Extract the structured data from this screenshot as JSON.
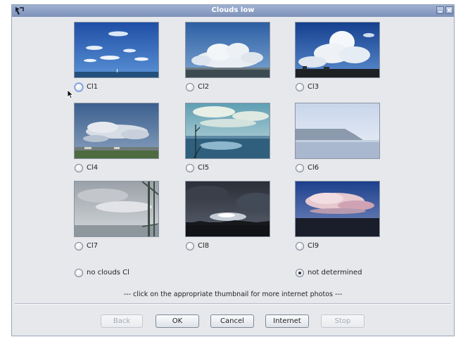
{
  "window": {
    "title": "Clouds low"
  },
  "options": [
    {
      "label": "Cl1",
      "selected": false,
      "focused": true
    },
    {
      "label": "Cl2",
      "selected": false
    },
    {
      "label": "Cl3",
      "selected": false
    },
    {
      "label": "Cl4",
      "selected": false
    },
    {
      "label": "Cl5",
      "selected": false
    },
    {
      "label": "Cl6",
      "selected": false
    },
    {
      "label": "Cl7",
      "selected": false
    },
    {
      "label": "Cl8",
      "selected": false
    },
    {
      "label": "Cl9",
      "selected": false
    }
  ],
  "extra_options": {
    "no_clouds": {
      "label": "no clouds Cl",
      "selected": false
    },
    "not_determined": {
      "label": "not determined",
      "selected": true
    }
  },
  "hint": "--- click on the appropriate thumbnail for more internet photos ---",
  "buttons": {
    "back": {
      "label": "Back",
      "enabled": false
    },
    "ok": {
      "label": "OK",
      "enabled": true
    },
    "cancel": {
      "label": "Cancel",
      "enabled": true
    },
    "internet": {
      "label": "Internet",
      "enabled": true
    },
    "stop": {
      "label": "Stop",
      "enabled": false
    }
  },
  "icons": {
    "app": "app-icon",
    "minimize": "minimize-icon",
    "close": "close-icon",
    "cursor": "mouse-cursor-icon"
  },
  "colors": {
    "titlebar": "#8a9dc4",
    "window_bg": "#e6e8ec",
    "title_text": "#ffffff"
  }
}
